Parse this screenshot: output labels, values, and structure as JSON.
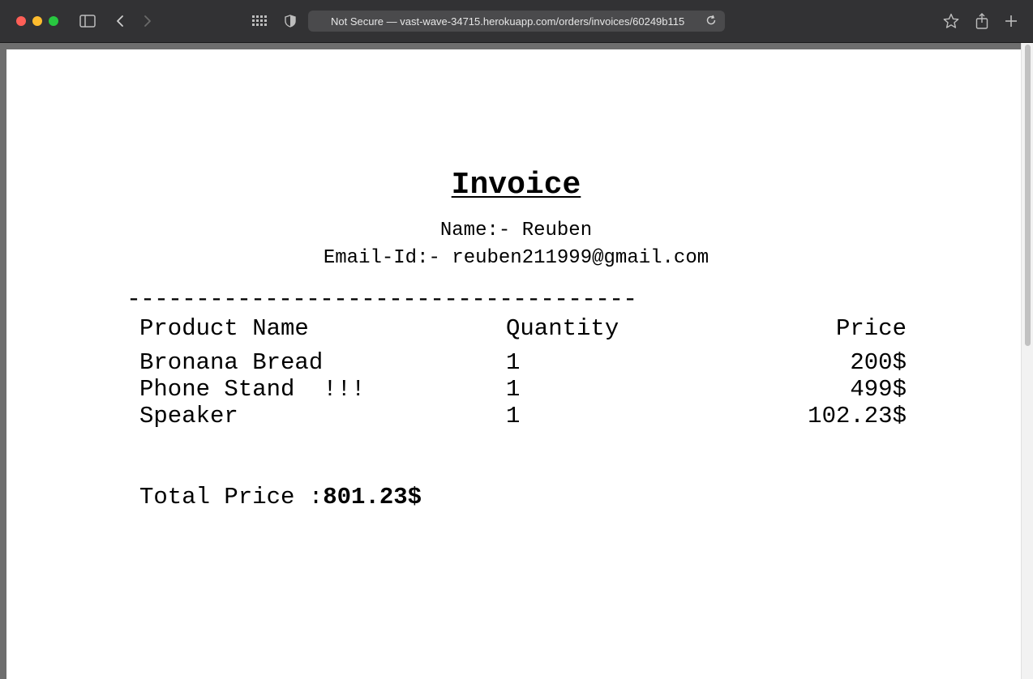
{
  "browser": {
    "url_text": "Not Secure — vast-wave-34715.herokuapp.com/orders/invoices/60249b115"
  },
  "invoice": {
    "title": "Invoice",
    "name_line": "Name:- Reuben",
    "email_line": "Email-Id:- reuben211999@gmail.com",
    "divider": "-------------------------------------",
    "headers": {
      "product": "Product Name",
      "quantity": "Quantity",
      "price": "Price"
    },
    "items": [
      {
        "product": "Bronana Bread",
        "quantity": "1",
        "price": "200$"
      },
      {
        "product": "Phone Stand  !!!",
        "quantity": "1",
        "price": "499$"
      },
      {
        "product": "Speaker",
        "quantity": "1",
        "price": "102.23$"
      }
    ],
    "total_label": "Total Price :",
    "total_value": "801.23$"
  }
}
